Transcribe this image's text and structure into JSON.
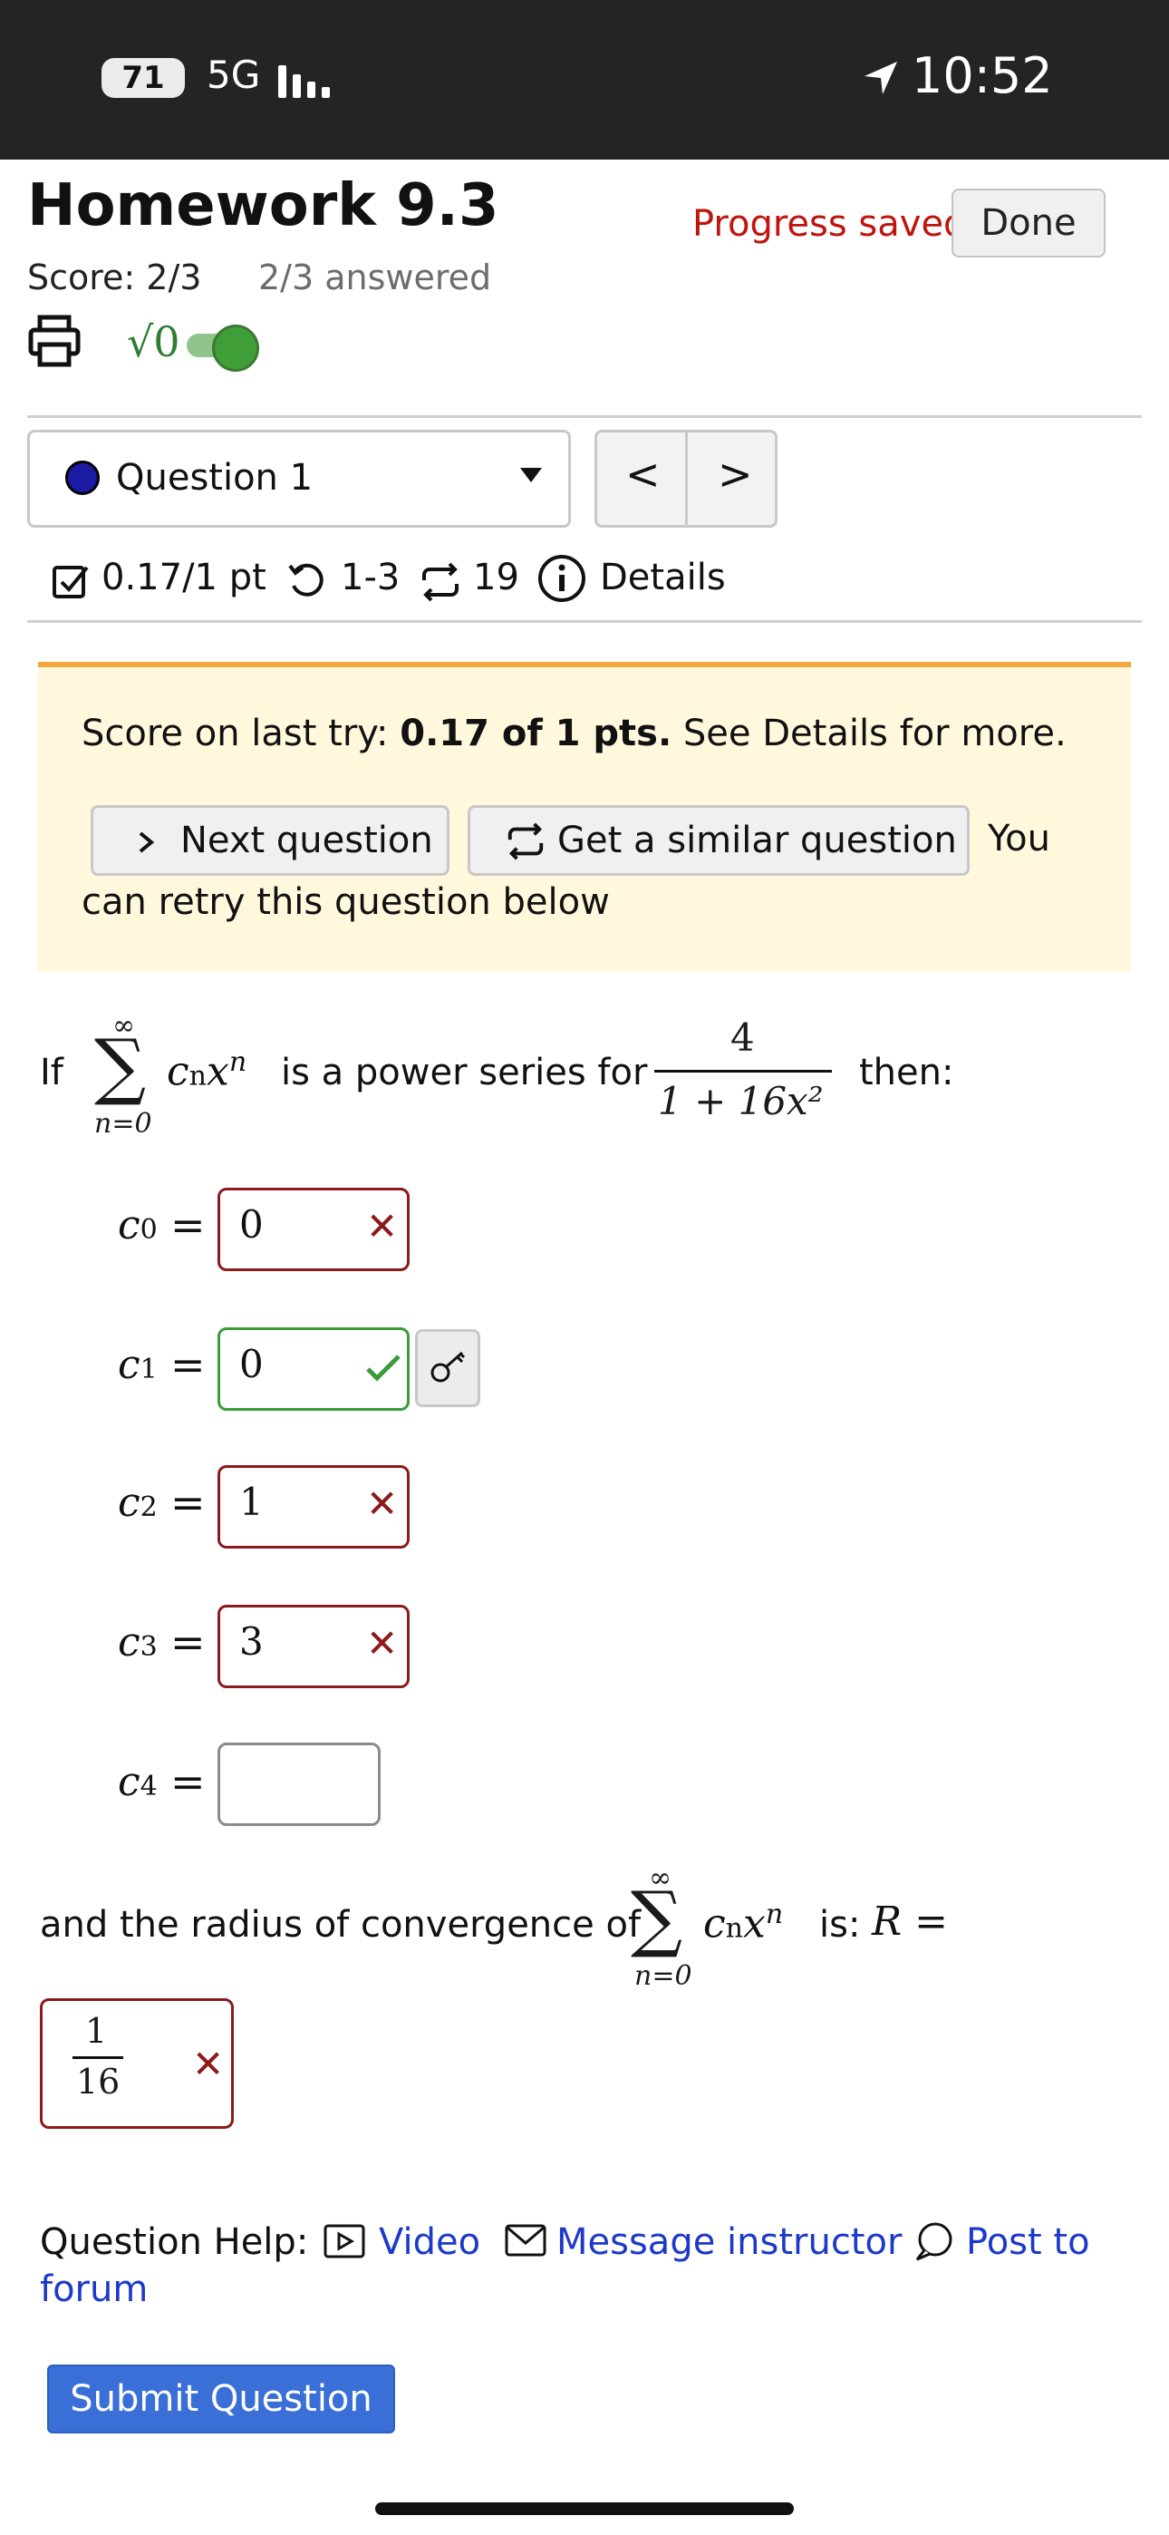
{
  "status_bar": {
    "battery": "71",
    "network": "5G",
    "time": "10:52"
  },
  "header": {
    "title": "Homework 9.3",
    "progress": "Progress saved",
    "done_label": "Done",
    "score": "Score: 2/3",
    "answered": "2/3 answered",
    "math_toggle_label": "√0"
  },
  "question_nav": {
    "selected": "Question 1",
    "prev": "<",
    "next": ">"
  },
  "question_meta": {
    "points": "0.17/1 pt",
    "attempts": "1-3",
    "versions": "19",
    "details": "Details"
  },
  "banner": {
    "score_prefix": "Score on last try: ",
    "score_value": "0.17 of 1 pts.",
    "score_suffix": " See Details for more.",
    "next_label": "Next question",
    "similar_label": "Get a similar question",
    "retry_text_1": "You",
    "retry_text_2": "can retry this question below"
  },
  "problem": {
    "if": "If",
    "sum_top": "∞",
    "sum_bottom": "n=0",
    "middle": "is a power series for",
    "numerator": "4",
    "denominator": "1 + 16x²",
    "then": "then:",
    "radius_text": "and the radius of convergence of",
    "radius_is": "is:",
    "radius_var": "R =",
    "radius_num": "1",
    "radius_den": "16"
  },
  "answers": [
    {
      "label": "c",
      "sub": "0",
      "value": "0",
      "status": "wrong"
    },
    {
      "label": "c",
      "sub": "1",
      "value": "0",
      "status": "correct"
    },
    {
      "label": "c",
      "sub": "2",
      "value": "1",
      "status": "wrong"
    },
    {
      "label": "c",
      "sub": "3",
      "value": "3",
      "status": "wrong"
    },
    {
      "label": "c",
      "sub": "4",
      "value": "",
      "status": "empty"
    }
  ],
  "help": {
    "label": "Question Help:",
    "video": "Video",
    "message": "Message instructor",
    "post_1": "Post to",
    "post_2": "forum"
  },
  "submit_label": "Submit Question",
  "colors": {
    "wrong": "#8b1a1a",
    "correct": "#3b9b36",
    "link": "#1c39c9",
    "submit": "#3a6fd8",
    "banner": "#fff8dd"
  }
}
